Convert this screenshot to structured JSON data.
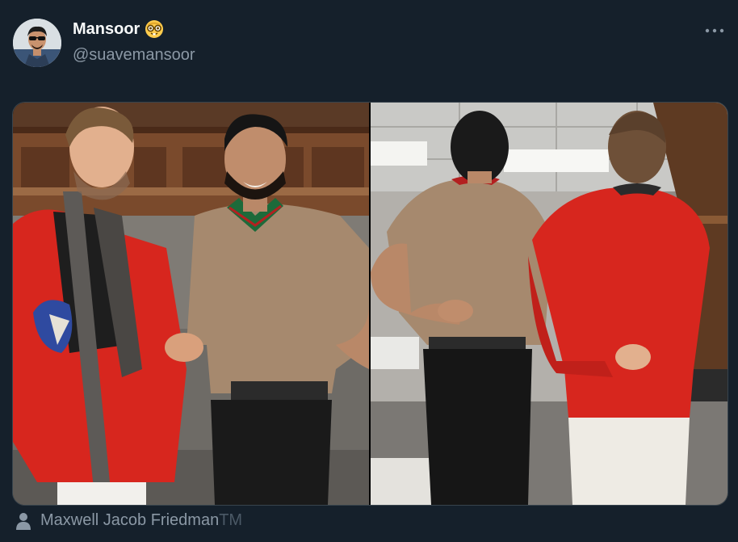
{
  "author": {
    "display_name": "Mansoor",
    "handle": "@suavemansoor",
    "badge_emoji": "nerd-face-emoji",
    "avatar": "profile-photo"
  },
  "header": {
    "more_icon": "more-horizontal-icon"
  },
  "media": {
    "photos": [
      {
        "name": "photo-handshake-locker-room"
      },
      {
        "name": "photo-backs-crossed-fingers"
      }
    ]
  },
  "tagged_user": {
    "icon": "person-icon",
    "name": "Maxwell Jacob Friedman",
    "suffix": "TM"
  },
  "colors": {
    "background": "#15202b",
    "primary_text": "#f7f9f9",
    "secondary_text": "#8b98a5",
    "border": "#38444d"
  }
}
